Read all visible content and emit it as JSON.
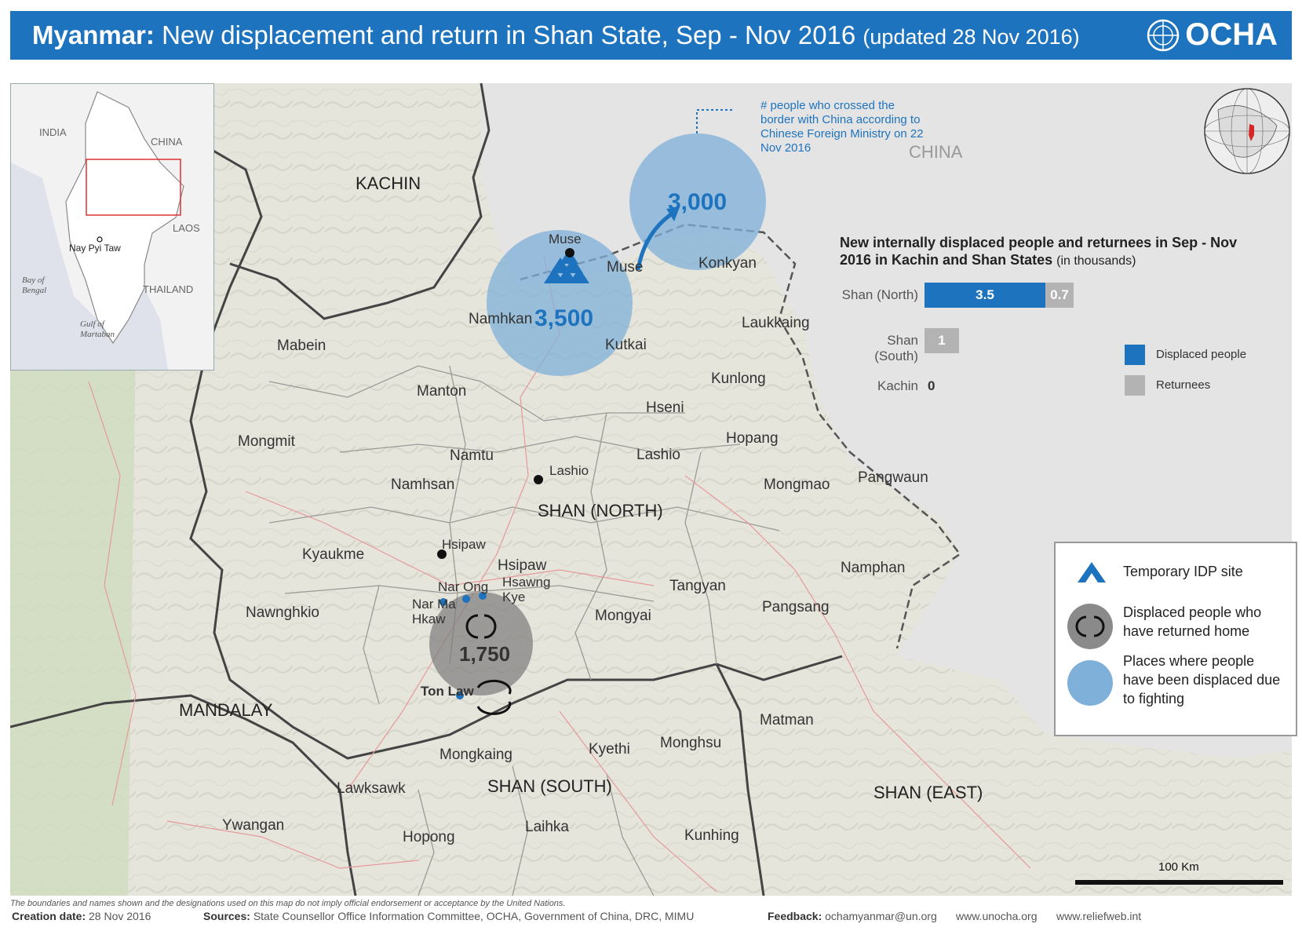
{
  "header": {
    "title_bold": "Myanmar:",
    "title_main": "New displacement and return in Shan State, Sep - Nov 2016",
    "title_updated": "(updated 28 Nov 2016)",
    "logo_text": "OCHA",
    "bar_color": "#1e73be"
  },
  "inset_map": {
    "labels": [
      "INDIA",
      "CHINA",
      "LAOS",
      "THAILAND",
      "Nay Pyi Taw",
      "Bay of Bengal",
      "Gulf of Martaban"
    ]
  },
  "map": {
    "region_labels": {
      "kachin": "KACHIN",
      "china": "CHINA",
      "shan_north": "SHAN (NORTH)",
      "shan_south": "SHAN (SOUTH)",
      "shan_east": "SHAN (EAST)",
      "mandalay": "MANDALAY"
    },
    "towns": {
      "muse_town": "Muse",
      "muse": "Muse",
      "konkyan": "Konkyan",
      "namhkan": "Namhkan",
      "kutkai": "Kutkai",
      "laukkaing": "Laukkaing",
      "mabein": "Mabein",
      "manton": "Manton",
      "kunlong": "Kunlong",
      "hseni": "Hseni",
      "mongmit": "Mongmit",
      "namtu": "Namtu",
      "lashio_town": "Lashio",
      "lashio": "Lashio",
      "hopang": "Hopang",
      "namhsan": "Namhsan",
      "mongmao": "Mongmao",
      "pangwaun": "Pangwaun",
      "kyaukme": "Kyaukme",
      "hsipaw_town": "Hsipaw",
      "hsipaw": "Hsipaw",
      "nar_ong": "Nar Ong",
      "hsawng_kye": "Hsawng Kye",
      "nar_ma_hkaw": "Nar Ma Hkaw",
      "namphan": "Namphan",
      "tangyan": "Tangyan",
      "nawnghkio": "Nawnghkio",
      "mongyai": "Mongyai",
      "pangsang": "Pangsang",
      "ton_law": "Ton Law",
      "matman": "Matman",
      "kyethi": "Kyethi",
      "monghsu": "Monghsu",
      "mongkaing": "Mongkaing",
      "lawksawk": "Lawksawk",
      "ywangan": "Ywangan",
      "hopong": "Hopong",
      "laihka": "Laihka",
      "kunhing": "Kunhing"
    },
    "annotation_china_crossing": "# people who crossed the border with China according to Chinese Foreign Ministry on 22 Nov 2016",
    "bubbles": {
      "crossed_china": "3,000",
      "displaced_muse": "3,500",
      "returned_hsipaw": "1,750"
    },
    "colors": {
      "displaced_bubble": "#7fb0da",
      "returned_bubble": "#8a8a8a",
      "land": "#e7e6dd",
      "china": "#e4e4e4"
    }
  },
  "chart_data": {
    "type": "bar",
    "title": "New internally displaced people and returnees in Sep - Nov 2016 in Kachin and Shan States",
    "unit": "(in thousands)",
    "categories": [
      "Shan (North)",
      "Shan (South)",
      "Kachin"
    ],
    "series": [
      {
        "name": "Displaced people",
        "values": [
          3.5,
          0,
          0
        ],
        "labels": [
          "3.5",
          "",
          ""
        ],
        "color": "#1e73be"
      },
      {
        "name": "Returnees",
        "values": [
          0.7,
          1,
          0
        ],
        "labels": [
          "0.7",
          "1",
          ""
        ],
        "color": "#b3b3b3"
      }
    ],
    "zero_label": "0",
    "stacked": true,
    "orientation": "horizontal",
    "legend_position": "right"
  },
  "legend": {
    "idp_site": "Temporary IDP site",
    "returned": "Displaced people who have returned home",
    "displaced": "Places where people have been displaced due to fighting"
  },
  "scale": {
    "label": "100 Km"
  },
  "footer": {
    "disclaimer": "The boundaries and names shown and the designations used on this map do not imply official endorsement or acceptance by the United Nations.",
    "creation_label": "Creation date:",
    "creation_value": "28 Nov 2016",
    "sources_label": "Sources:",
    "sources_value": "State Counsellor Office Information Committee, OCHA, Government of China, DRC, MIMU",
    "feedback_label": "Feedback:",
    "feedback_value": "ochamyanmar@un.org",
    "site1": "www.unocha.org",
    "site2": "www.reliefweb.int"
  }
}
